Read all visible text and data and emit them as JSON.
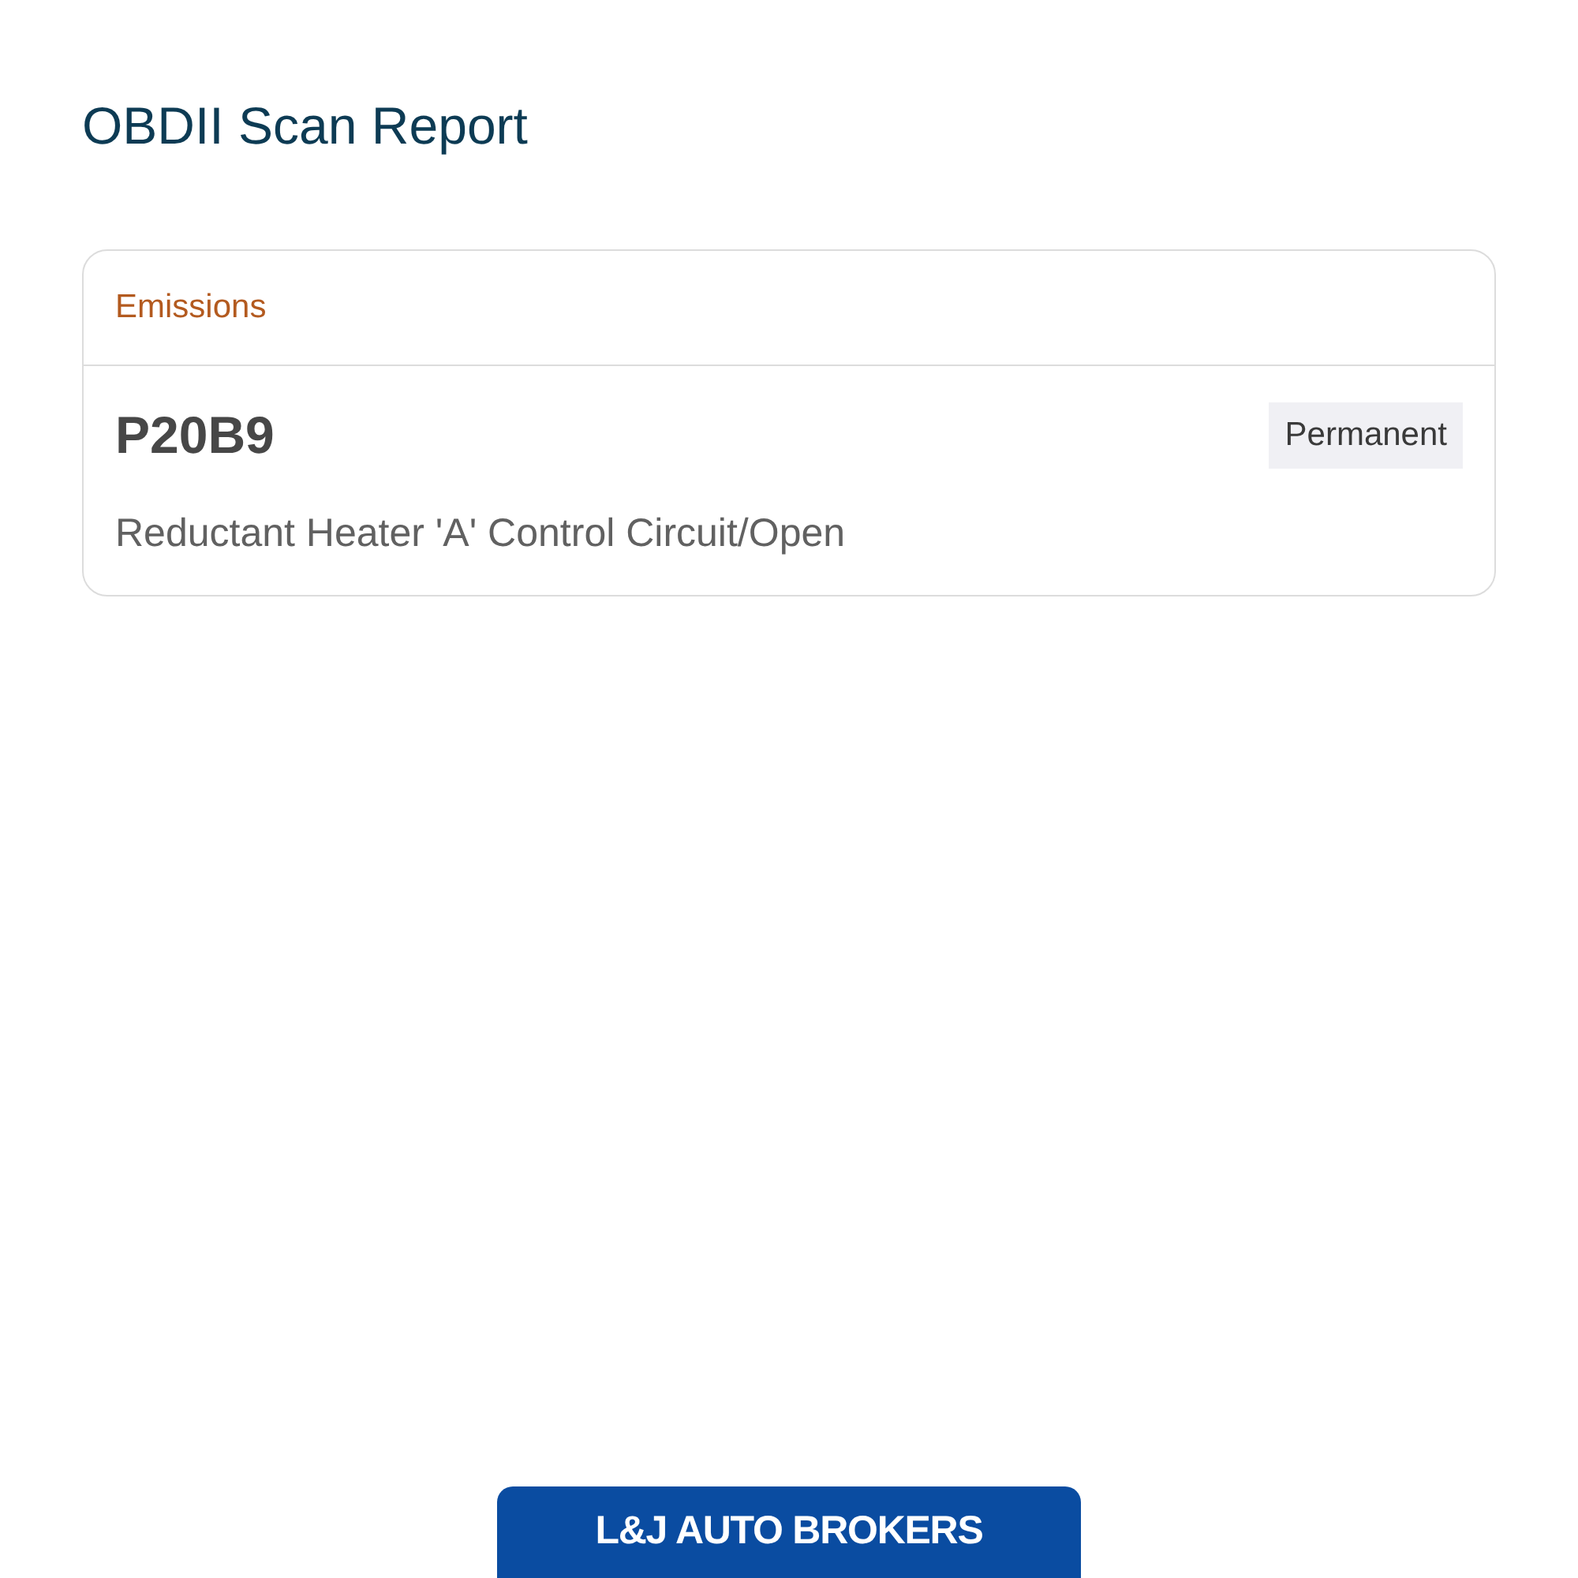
{
  "title": "OBDII Scan Report",
  "sections": [
    {
      "name": "Emissions",
      "codes": [
        {
          "code": "P20B9",
          "status": "Permanent",
          "description": "Reductant Heater 'A' Control Circuit/Open"
        }
      ]
    }
  ],
  "footer": {
    "logo": "L&J AUTO BROKERS"
  }
}
